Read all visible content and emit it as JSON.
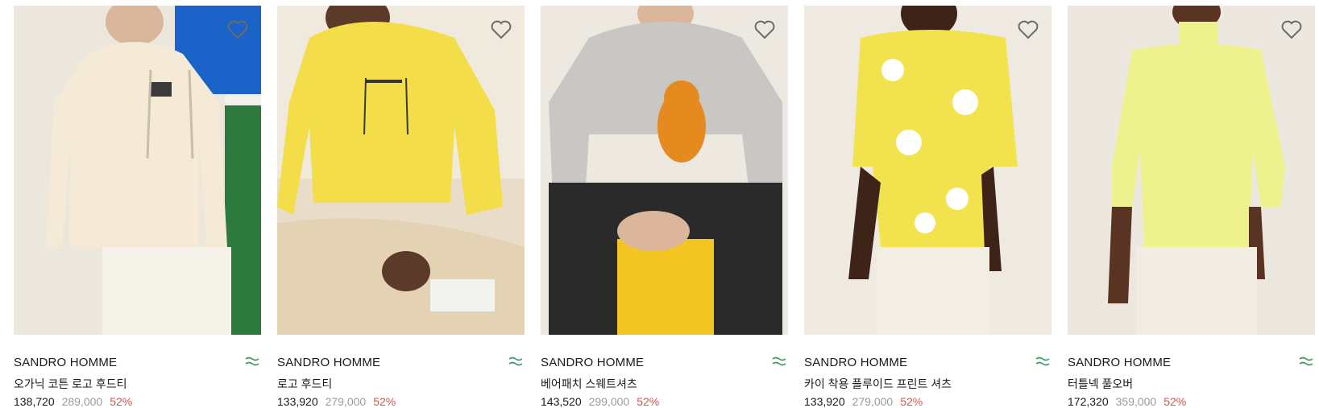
{
  "products": [
    {
      "brand": "SANDRO HOMME",
      "name": "오가닉 코튼 로고 후드티",
      "sale_price": "138,720",
      "original_price": "289,000",
      "discount": "52%"
    },
    {
      "brand": "SANDRO HOMME",
      "name": "로고 후드티",
      "sale_price": "133,920",
      "original_price": "279,000",
      "discount": "52%"
    },
    {
      "brand": "SANDRO HOMME",
      "name": "베어패치 스웨트셔츠",
      "sale_price": "143,520",
      "original_price": "299,000",
      "discount": "52%"
    },
    {
      "brand": "SANDRO HOMME",
      "name": "카이 착용 플루이드 프린트 셔츠",
      "sale_price": "133,920",
      "original_price": "279,000",
      "discount": "52%"
    },
    {
      "brand": "SANDRO HOMME",
      "name": "터틀넥 풀오버",
      "sale_price": "172,320",
      "original_price": "359,000",
      "discount": "52%"
    }
  ],
  "icons": {
    "wishlist": "heart-outline-icon",
    "brand_logo": "sandro-logo-icon"
  },
  "colors": {
    "discount": "#d0574b",
    "original_price": "#9a9a9a",
    "text": "#1a1a1a",
    "logo_green": "#3c9a5f"
  }
}
